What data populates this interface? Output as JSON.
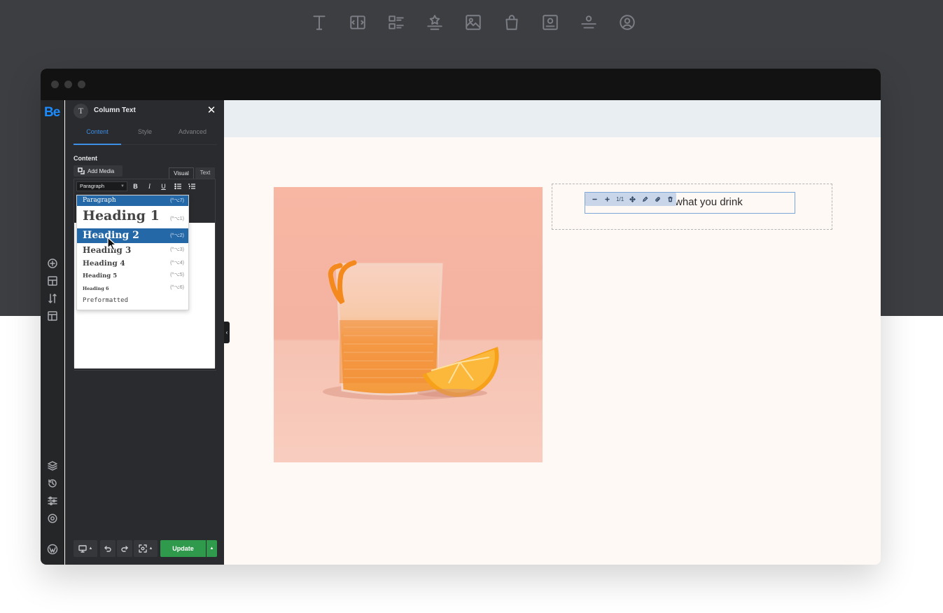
{
  "top_icons": [
    "text-icon",
    "columns-icon",
    "list-icon",
    "rating-icon",
    "image-icon",
    "bag-icon",
    "portrait-icon",
    "divider-icon",
    "avatar-icon"
  ],
  "app": {
    "logo": "Be"
  },
  "panel": {
    "badge": "T",
    "title": "Column Text",
    "tabs": [
      "Content",
      "Style",
      "Advanced"
    ],
    "active_tab": "Content",
    "section_label": "Content",
    "add_media": "Add Media",
    "editor_tabs": {
      "visual": "Visual",
      "text": "Text"
    },
    "format_select": "Paragraph",
    "format_options": [
      {
        "label": "Paragraph",
        "shortcut": "(^⌥7)"
      },
      {
        "label": "Heading 1",
        "shortcut": "(^⌥1)"
      },
      {
        "label": "Heading 2",
        "shortcut": "(^⌥2)"
      },
      {
        "label": "Heading 3",
        "shortcut": "(^⌥3)"
      },
      {
        "label": "Heading 4",
        "shortcut": "(^⌥4)"
      },
      {
        "label": "Heading 5",
        "shortcut": "(^⌥5)"
      },
      {
        "label": "Heading 6",
        "shortcut": "(^⌥6)"
      },
      {
        "label": "Preformatted",
        "shortcut": ""
      }
    ],
    "selected_options": [
      "Paragraph",
      "Heading 2"
    ],
    "update_label": "Update"
  },
  "canvas": {
    "heading_text": "what you drink",
    "mini_toolbar": [
      "minus-icon",
      "plus-icon",
      "1/1",
      "move-icon",
      "edit-icon",
      "link-icon",
      "trash-icon"
    ],
    "mini_toolbar_width_label": "1/1"
  },
  "colors": {
    "background_dark": "#3c3e42",
    "panel": "#2a2b2e",
    "accent_blue": "#3d8fe6",
    "selected_item": "#2468a8",
    "update_green": "#2f9a4c",
    "canvas_bg": "#fff9f5",
    "logo_blue": "#1a8cff"
  }
}
